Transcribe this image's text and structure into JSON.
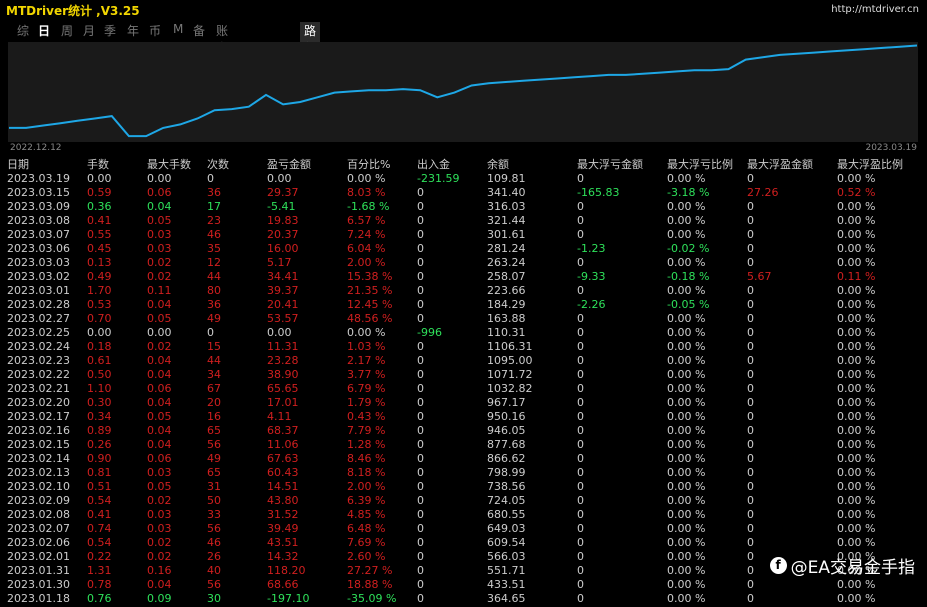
{
  "window": {
    "title": "MTDriver统计 ,V3.25",
    "url": "http://mtdriver.cn"
  },
  "tabs": [
    "综",
    "日",
    "周",
    "月",
    "季",
    "年",
    "币",
    "M",
    "备",
    "账户"
  ],
  "active_tab": "日",
  "path_button": "路径",
  "chart": {
    "start_date": "2022.12.12",
    "end_date": "2023.03.19",
    "line_color": "#1ea7e6"
  },
  "chart_data": {
    "type": "line",
    "title": "",
    "xlabel": "",
    "ylabel": "",
    "x": [
      "2022.12.12",
      "2023.03.19"
    ],
    "series": [
      {
        "values": [
          92,
          92,
          94,
          96,
          98,
          100,
          102,
          85,
          85,
          92,
          95,
          100,
          107,
          108,
          110,
          120,
          112,
          114,
          118,
          122,
          123,
          124,
          124,
          125,
          124,
          118,
          122,
          128,
          130,
          131,
          132,
          133,
          134,
          135,
          136,
          137,
          137,
          138,
          139,
          140,
          141,
          141,
          142,
          150,
          152,
          154,
          155,
          156,
          157,
          158,
          159,
          160,
          161,
          162
        ]
      }
    ]
  },
  "table": {
    "headers": [
      "日期",
      "手数",
      "最大手数",
      "次数",
      "盈亏金额",
      "百分比%",
      "出入金",
      "余额",
      "最大浮亏金额",
      "最大浮亏比例",
      "最大浮盈金额",
      "最大浮盈比例"
    ],
    "rows": [
      [
        "2023.03.19",
        "0.00",
        "0.00",
        "0",
        "0.00",
        "0.00 %",
        "-231.59",
        "109.81",
        "0",
        "0.00 %",
        "0",
        "0.00 %"
      ],
      [
        "2023.03.15",
        "0.59",
        "0.06",
        "36",
        "29.37",
        "8.03 %",
        "0",
        "341.40",
        "-165.83",
        "-3.18 %",
        "27.26",
        "0.52 %"
      ],
      [
        "2023.03.09",
        "0.36",
        "0.04",
        "17",
        "-5.41",
        "-1.68 %",
        "0",
        "316.03",
        "0",
        "0.00 %",
        "0",
        "0.00 %"
      ],
      [
        "2023.03.08",
        "0.41",
        "0.05",
        "23",
        "19.83",
        "6.57 %",
        "0",
        "321.44",
        "0",
        "0.00 %",
        "0",
        "0.00 %"
      ],
      [
        "2023.03.07",
        "0.55",
        "0.03",
        "46",
        "20.37",
        "7.24 %",
        "0",
        "301.61",
        "0",
        "0.00 %",
        "0",
        "0.00 %"
      ],
      [
        "2023.03.06",
        "0.45",
        "0.03",
        "35",
        "16.00",
        "6.04 %",
        "0",
        "281.24",
        "-1.23",
        "-0.02 %",
        "0",
        "0.00 %"
      ],
      [
        "2023.03.03",
        "0.13",
        "0.02",
        "12",
        "5.17",
        "2.00 %",
        "0",
        "263.24",
        "0",
        "0.00 %",
        "0",
        "0.00 %"
      ],
      [
        "2023.03.02",
        "0.49",
        "0.02",
        "44",
        "34.41",
        "15.38 %",
        "0",
        "258.07",
        "-9.33",
        "-0.18 %",
        "5.67",
        "0.11 %"
      ],
      [
        "2023.03.01",
        "1.70",
        "0.11",
        "80",
        "39.37",
        "21.35 %",
        "0",
        "223.66",
        "0",
        "0.00 %",
        "0",
        "0.00 %"
      ],
      [
        "2023.02.28",
        "0.53",
        "0.04",
        "36",
        "20.41",
        "12.45 %",
        "0",
        "184.29",
        "-2.26",
        "-0.05 %",
        "0",
        "0.00 %"
      ],
      [
        "2023.02.27",
        "0.70",
        "0.05",
        "49",
        "53.57",
        "48.56 %",
        "0",
        "163.88",
        "0",
        "0.00 %",
        "0",
        "0.00 %"
      ],
      [
        "2023.02.25",
        "0.00",
        "0.00",
        "0",
        "0.00",
        "0.00 %",
        "-996",
        "110.31",
        "0",
        "0.00 %",
        "0",
        "0.00 %"
      ],
      [
        "2023.02.24",
        "0.18",
        "0.02",
        "15",
        "11.31",
        "1.03 %",
        "0",
        "1106.31",
        "0",
        "0.00 %",
        "0",
        "0.00 %"
      ],
      [
        "2023.02.23",
        "0.61",
        "0.04",
        "44",
        "23.28",
        "2.17 %",
        "0",
        "1095.00",
        "0",
        "0.00 %",
        "0",
        "0.00 %"
      ],
      [
        "2023.02.22",
        "0.50",
        "0.04",
        "34",
        "38.90",
        "3.77 %",
        "0",
        "1071.72",
        "0",
        "0.00 %",
        "0",
        "0.00 %"
      ],
      [
        "2023.02.21",
        "1.10",
        "0.06",
        "67",
        "65.65",
        "6.79 %",
        "0",
        "1032.82",
        "0",
        "0.00 %",
        "0",
        "0.00 %"
      ],
      [
        "2023.02.20",
        "0.30",
        "0.04",
        "20",
        "17.01",
        "1.79 %",
        "0",
        "967.17",
        "0",
        "0.00 %",
        "0",
        "0.00 %"
      ],
      [
        "2023.02.17",
        "0.34",
        "0.05",
        "16",
        "4.11",
        "0.43 %",
        "0",
        "950.16",
        "0",
        "0.00 %",
        "0",
        "0.00 %"
      ],
      [
        "2023.02.16",
        "0.89",
        "0.04",
        "65",
        "68.37",
        "7.79 %",
        "0",
        "946.05",
        "0",
        "0.00 %",
        "0",
        "0.00 %"
      ],
      [
        "2023.02.15",
        "0.26",
        "0.04",
        "56",
        "11.06",
        "1.28 %",
        "0",
        "877.68",
        "0",
        "0.00 %",
        "0",
        "0.00 %"
      ],
      [
        "2023.02.14",
        "0.90",
        "0.06",
        "49",
        "67.63",
        "8.46 %",
        "0",
        "866.62",
        "0",
        "0.00 %",
        "0",
        "0.00 %"
      ],
      [
        "2023.02.13",
        "0.81",
        "0.03",
        "65",
        "60.43",
        "8.18 %",
        "0",
        "798.99",
        "0",
        "0.00 %",
        "0",
        "0.00 %"
      ],
      [
        "2023.02.10",
        "0.51",
        "0.05",
        "31",
        "14.51",
        "2.00 %",
        "0",
        "738.56",
        "0",
        "0.00 %",
        "0",
        "0.00 %"
      ],
      [
        "2023.02.09",
        "0.54",
        "0.02",
        "50",
        "43.80",
        "6.39 %",
        "0",
        "724.05",
        "0",
        "0.00 %",
        "0",
        "0.00 %"
      ],
      [
        "2023.02.08",
        "0.41",
        "0.03",
        "33",
        "31.52",
        "4.85 %",
        "0",
        "680.55",
        "0",
        "0.00 %",
        "0",
        "0.00 %"
      ],
      [
        "2023.02.07",
        "0.74",
        "0.03",
        "56",
        "39.49",
        "6.48 %",
        "0",
        "649.03",
        "0",
        "0.00 %",
        "0",
        "0.00 %"
      ],
      [
        "2023.02.06",
        "0.54",
        "0.02",
        "46",
        "43.51",
        "7.69 %",
        "0",
        "609.54",
        "0",
        "0.00 %",
        "0",
        "0.00 %"
      ],
      [
        "2023.02.01",
        "0.22",
        "0.02",
        "26",
        "14.32",
        "2.60 %",
        "0",
        "566.03",
        "0",
        "0.00 %",
        "0",
        "0.00 %"
      ],
      [
        "2023.01.31",
        "1.31",
        "0.16",
        "40",
        "118.20",
        "27.27 %",
        "0",
        "551.71",
        "0",
        "0.00 %",
        "0",
        "0.00 %"
      ],
      [
        "2023.01.30",
        "0.78",
        "0.04",
        "56",
        "68.66",
        "18.88 %",
        "0",
        "433.51",
        "0",
        "0.00 %",
        "0",
        "0.00 %"
      ],
      [
        "2023.01.18",
        "0.76",
        "0.09",
        "30",
        "-197.10",
        "-35.09 %",
        "0",
        "364.65",
        "0",
        "0.00 %",
        "0",
        "0.00 %"
      ]
    ]
  },
  "watermark": {
    "icon": "f",
    "text": "@EA交易金手指"
  }
}
